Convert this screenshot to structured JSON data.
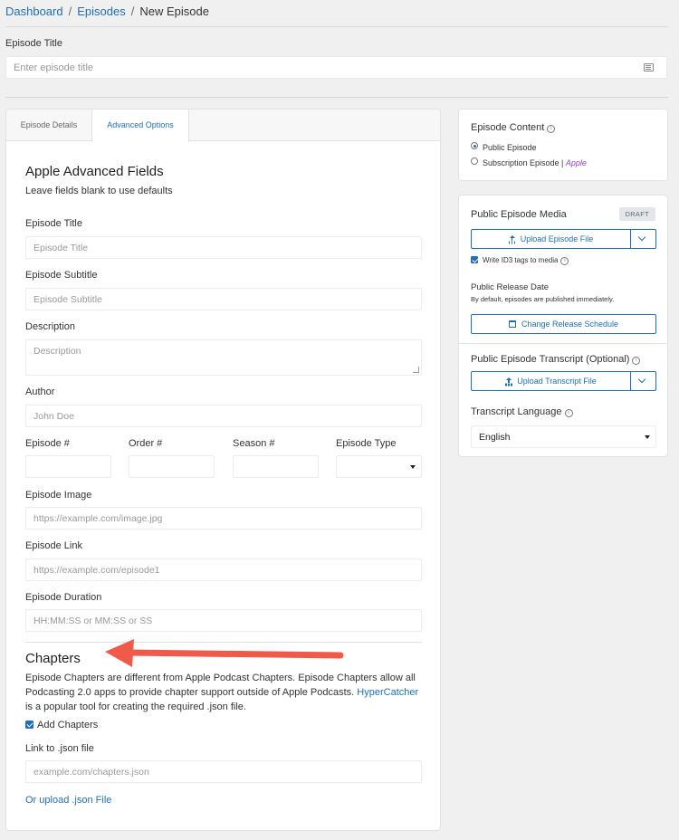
{
  "breadcrumb": {
    "dashboard": "Dashboard",
    "episodes": "Episodes",
    "current": "New Episode",
    "separator": "/"
  },
  "episode_title": {
    "label": "Episode Title",
    "placeholder": "Enter episode title"
  },
  "tabs": {
    "details": "Episode Details",
    "advanced": "Advanced Options"
  },
  "apple": {
    "heading": "Apple Advanced Fields",
    "subheading": "Leave fields blank to use defaults",
    "title_label": "Episode Title",
    "title_placeholder": "Episode Title",
    "subtitle_label": "Episode Subtitle",
    "subtitle_placeholder": "Episode Subtitle",
    "description_label": "Description",
    "description_placeholder": "Description",
    "author_label": "Author",
    "author_placeholder": "John Doe",
    "episode_num_label": "Episode #",
    "order_label": "Order #",
    "season_label": "Season #",
    "type_label": "Episode Type",
    "image_label": "Episode Image",
    "image_placeholder": "https://example.com/image.jpg",
    "link_label": "Episode Link",
    "link_placeholder": "https://example.com/episode1",
    "duration_label": "Episode Duration",
    "duration_placeholder": "HH:MM:SS or MM:SS or SS"
  },
  "chapters": {
    "heading": "Chapters",
    "description_before": "Episode Chapters are different from Apple Podcast Chapters. Episode Chapters allow all Podcasting 2.0 apps to provide chapter support outside of Apple Podcasts. ",
    "hypercatcher": "HyperCatcher",
    "description_after": " is a popular tool for creating the required .json file.",
    "add_label": "Add Chapters",
    "add_checked": true,
    "json_label": "Link to .json file",
    "json_placeholder": "example.com/chapters.json",
    "upload_link": "Or upload .json File"
  },
  "content": {
    "title": "Episode Content",
    "info": "i",
    "public": "Public Episode",
    "subscription": "Subscription Episode |",
    "apple": "Apple",
    "selected": "public"
  },
  "media": {
    "title": "Public Episode Media",
    "badge": "DRAFT",
    "upload_button": "Upload Episode File",
    "id3_label": "Write ID3 tags to media",
    "id3_checked": true,
    "info": "i",
    "release_title": "Public Release Date",
    "release_note": "By default, episodes are published immediately.",
    "schedule_button": "Change Release Schedule",
    "transcript_title": "Public Episode Transcript (Optional)",
    "transcript_button": "Upload Transcript File",
    "language_title": "Transcript Language",
    "language_value": "English"
  },
  "colors": {
    "link": "#1e6fb8",
    "annotation_arrow": "#ef5a4b",
    "apple": "#9a3ccc"
  }
}
